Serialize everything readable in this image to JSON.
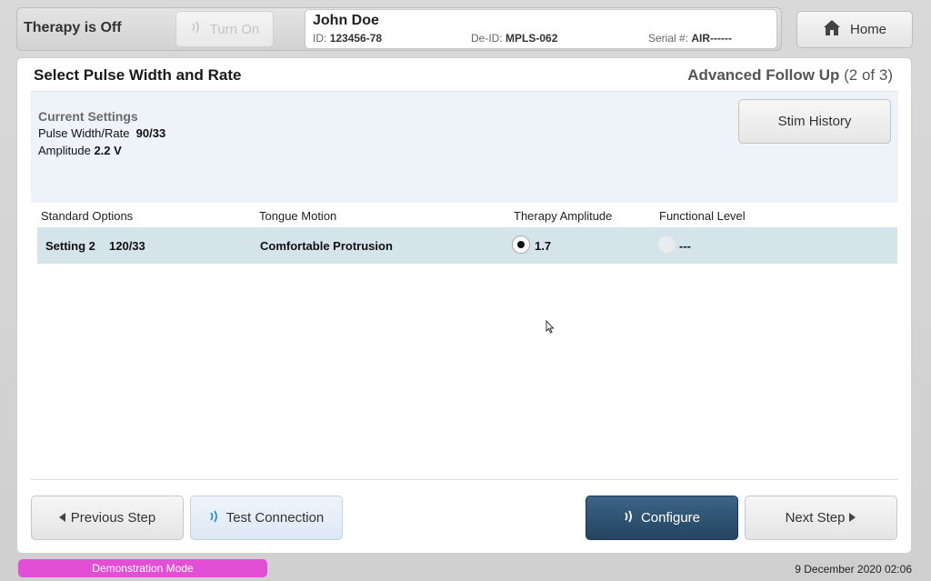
{
  "header": {
    "therapy_status": "Therapy is Off",
    "turn_on_label": "Turn On",
    "home_label": "Home"
  },
  "patient": {
    "name": "John Doe",
    "id_label": "ID:",
    "id_value": "123456-78",
    "deid_label": "De-ID:",
    "deid_value": "MPLS-062",
    "serial_label": "Serial #:",
    "serial_value": "AIR------"
  },
  "page": {
    "title": "Select Pulse Width and Rate",
    "step_name": "Advanced Follow Up",
    "step_progress": "(2 of 3)"
  },
  "current_settings": {
    "title": "Current Settings",
    "pulse_label": "Pulse Width/Rate",
    "pulse_value": "90/33",
    "amp_label": "Amplitude",
    "amp_value": "2.2 V",
    "stim_history_label": "Stim History"
  },
  "options_table": {
    "headers": [
      "Standard Options",
      "Tongue Motion",
      "Therapy Amplitude",
      "Functional Level"
    ],
    "rows": [
      {
        "setting": "Setting 2",
        "pulse": "120/33",
        "tongue_motion": "Comfortable Protrusion",
        "therapy_amplitude": "1.7",
        "therapy_amplitude_selected": true,
        "functional_level": "---",
        "functional_level_selected": false
      }
    ]
  },
  "footer_buttons": {
    "previous": "Previous Step",
    "test": "Test Connection",
    "configure": "Configure",
    "next": "Next Step"
  },
  "status": {
    "mode": "Demonstration Mode",
    "datetime": "9 December 2020 02:06"
  },
  "colors": {
    "configure_bg": "#2f5577",
    "demo_mode_bg": "#e24fd4",
    "row_highlight": "#d5e3ea",
    "settings_bg": "#eef3f9"
  },
  "icons": {
    "turn_on": "wireless-signal-icon",
    "home": "home-icon",
    "prev": "triangle-left-icon",
    "next": "triangle-right-icon",
    "test": "wireless-signal-icon",
    "configure": "wireless-signal-icon"
  }
}
